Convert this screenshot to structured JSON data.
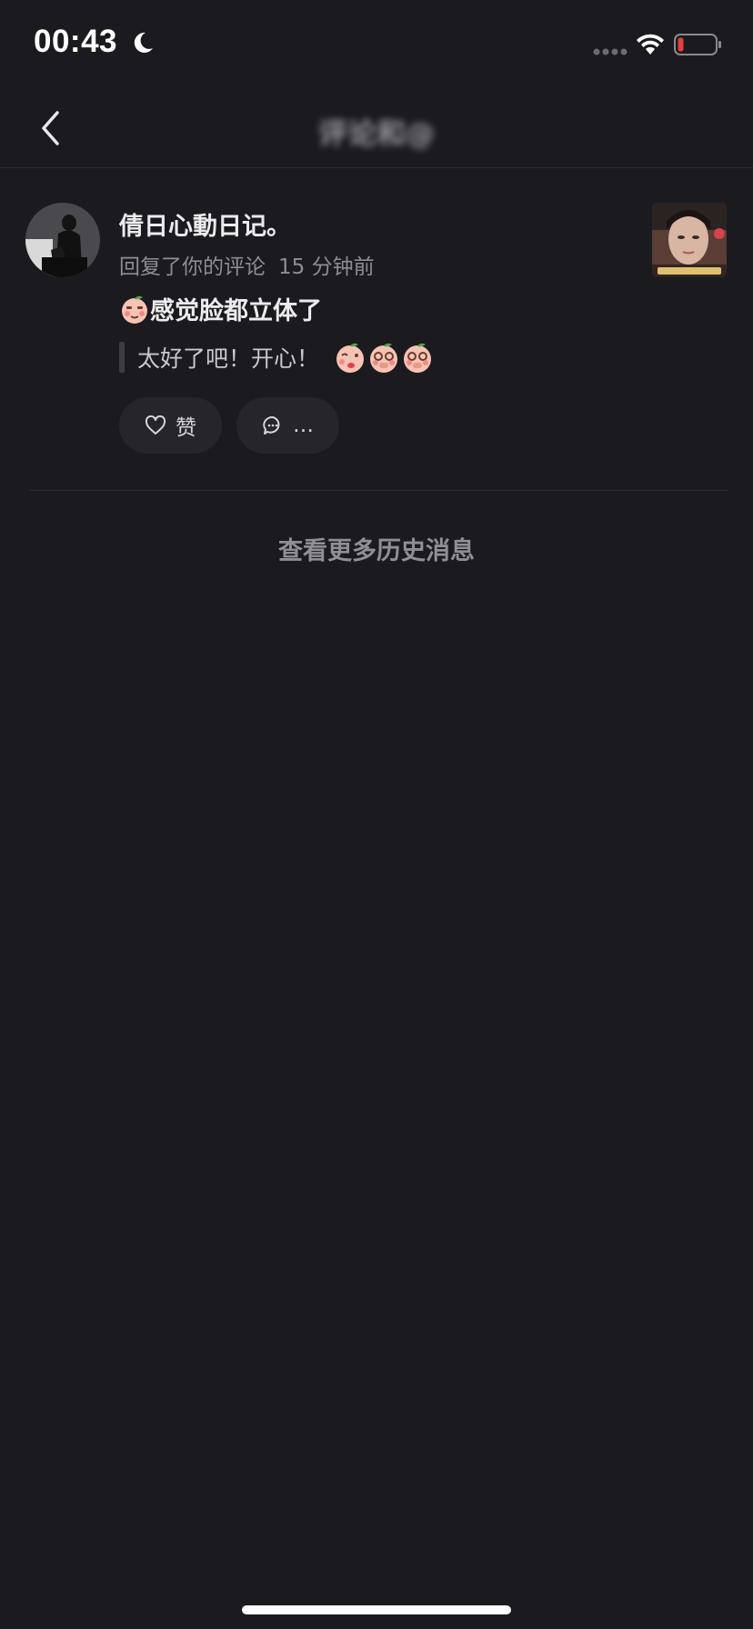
{
  "status_bar": {
    "time": "00:43",
    "icons": [
      "moon-icon",
      "signal-icon",
      "wifi-icon",
      "battery-icon"
    ],
    "battery_level": 0.1,
    "battery_color": "#e5413a"
  },
  "nav": {
    "back_icon": "chevron-left-icon",
    "title": "评论和@"
  },
  "notification": {
    "username": "倩日心動日记。",
    "action_text": "回复了你的评论",
    "time": "15 分钟前",
    "comment": "感觉脸都立体了",
    "quoted_reply": "太好了吧！开心！",
    "like_label": "赞",
    "reply_label": "…"
  },
  "footer": {
    "more_history": "查看更多历史消息"
  },
  "colors": {
    "background": "#1b1a1f",
    "pill": "#26252b",
    "muted_text": "#8d8d93"
  }
}
